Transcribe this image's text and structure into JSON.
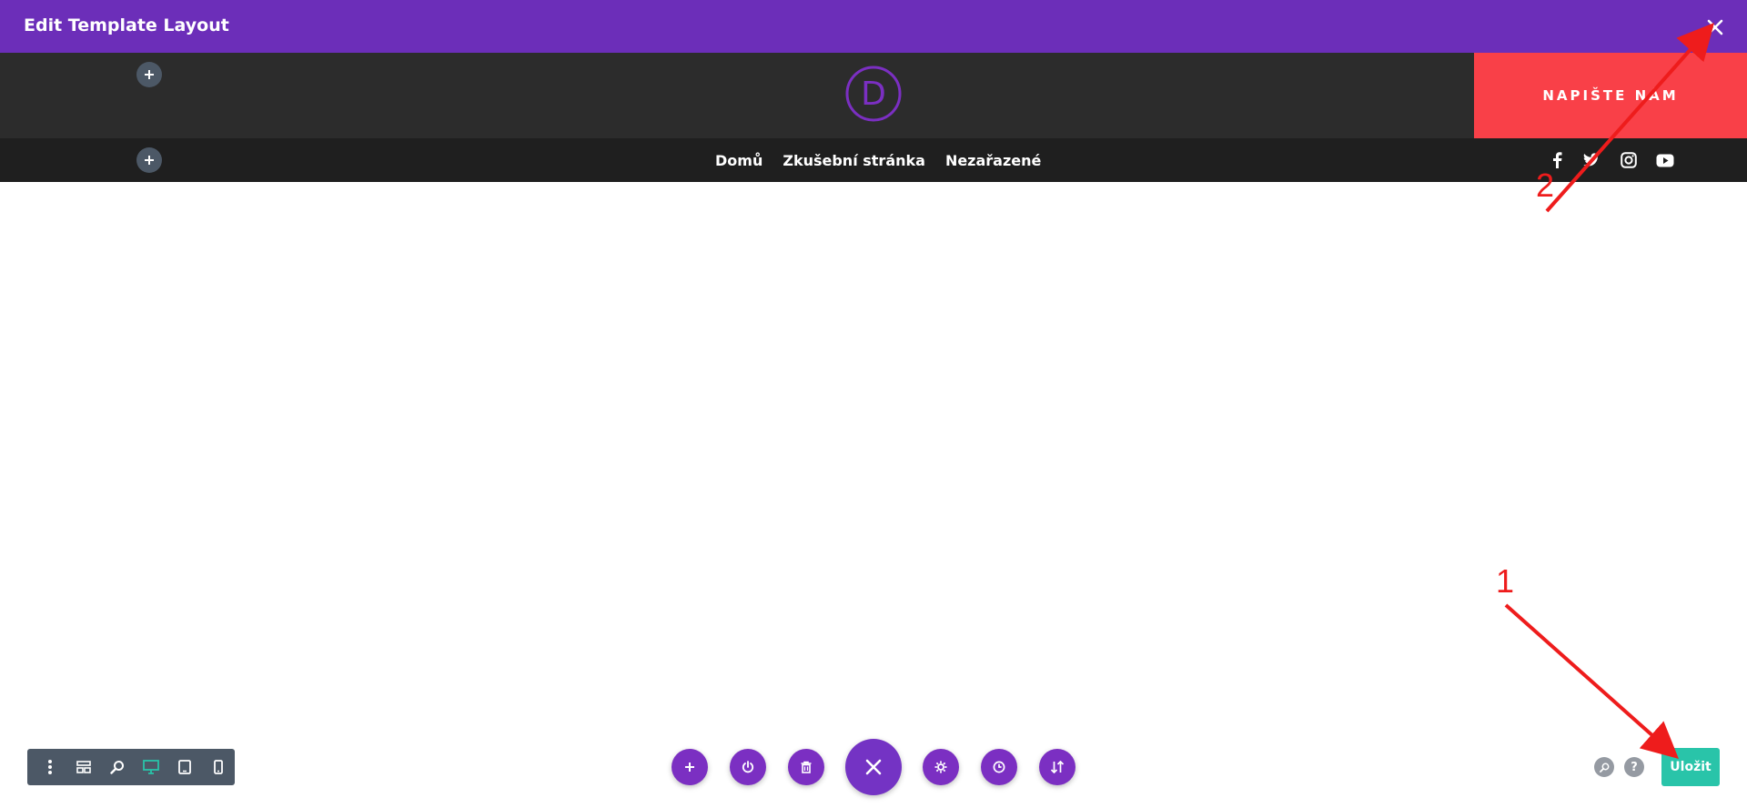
{
  "topbar": {
    "title": "Edit Template Layout",
    "close_icon": "close-icon",
    "background": "#6c2eb9"
  },
  "header": {
    "logo_letter": "D",
    "logo_color": "#7b2fc2",
    "background": "#2c2c2c",
    "cta_label": "NAPIŠTE NÁM",
    "cta_color": "#f94048"
  },
  "nav": {
    "items": [
      {
        "label": "Domů"
      },
      {
        "label": "Zkušební stránka"
      },
      {
        "label": "Nezařazené"
      }
    ],
    "social_icons": [
      "facebook-icon",
      "twitter-icon",
      "instagram-icon",
      "youtube-icon"
    ]
  },
  "left_toolbar": {
    "icons": [
      "more-vertical-icon",
      "wireframe-icon",
      "zoom-icon",
      "desktop-icon",
      "tablet-icon",
      "phone-icon"
    ],
    "active_color": "#29c4a9"
  },
  "center_toolbar": {
    "icons": [
      "add-icon",
      "power-icon",
      "trash-icon",
      "close-icon",
      "settings-icon",
      "history-icon",
      "sort-icon"
    ],
    "accent": "#7b2fc2"
  },
  "bottom_right": {
    "help_label": "?",
    "save_label": "Uložit",
    "save_color": "#29c4a9"
  },
  "annotations": {
    "marker_1": "1",
    "marker_2": "2",
    "color": "#ee1c1c"
  }
}
